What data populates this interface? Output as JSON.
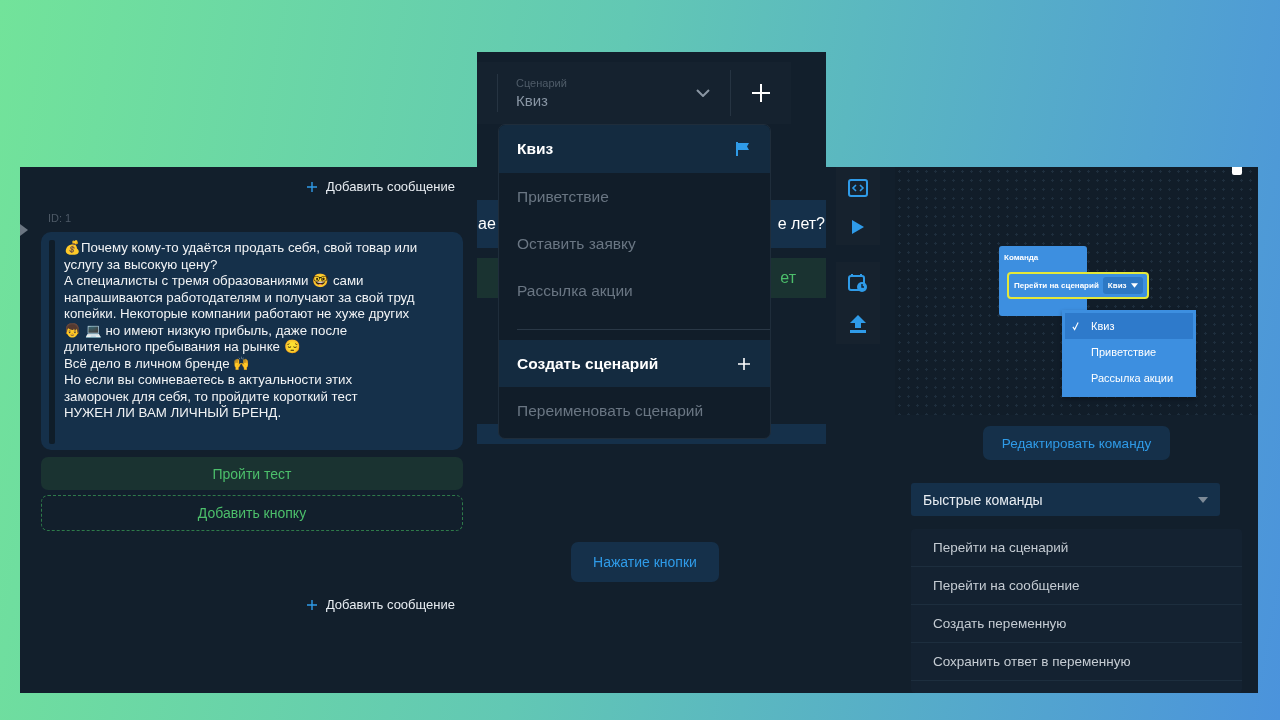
{
  "message_editor": {
    "add_message_top": "Добавить сообщение",
    "id_label": "ID: 1",
    "message": "💰Почему кому-то удаётся продать себя, свой товар или услугу за высокую цену?\nА специалисты с тремя образованиями 🤓 сами напрашиваются работодателям и получают за свой труд копейки. Некоторые компании работают не хуже других 👦 💻 но имеют низкую прибыль, даже после длительного пребывания на рынке 😔\nВсё дело в личном бренде 🙌\nНо если вы сомневаетесь в актуальности этих заморочек для себя, то пройдите короткий тест\nНУЖЕН ЛИ ВАМ ЛИЧНЫЙ БРЕНД.",
    "buttons": [
      {
        "label": "Пройти тест",
        "kind": "reply"
      },
      {
        "label": "Добавить кнопку",
        "kind": "add"
      }
    ],
    "add_message_bottom": "Добавить сообщение"
  },
  "scenario_panel": {
    "select_label": "Сценарий",
    "select_value": "Квиз",
    "scenarios": [
      {
        "label": "Квиз",
        "selected": true
      },
      {
        "label": "Приветствие",
        "selected": false
      },
      {
        "label": "Оставить заявку",
        "selected": false
      },
      {
        "label": "Рассылка акции",
        "selected": false
      }
    ],
    "actions": [
      {
        "label": "Создать сценарий",
        "kind": "create"
      },
      {
        "label": "Переименовать сценарий",
        "kind": "rename"
      }
    ],
    "question_fragments": [
      "ае",
      "е лет?"
    ],
    "answer_fragments": [
      "ет"
    ]
  },
  "trigger_button": "Нажатие кнопки",
  "block_editor": {
    "block_title": "Команда",
    "command": "Перейти на сценарий",
    "field_value": "Квиз",
    "options": [
      {
        "label": "Квиз",
        "selected": true
      },
      {
        "label": "Приветствие",
        "selected": false
      },
      {
        "label": "Рассылка акции",
        "selected": false
      }
    ],
    "edit_button": "Редактировать команду"
  },
  "quick_commands": {
    "title": "Быстрые команды",
    "items": [
      "Перейти на сценарий",
      "Перейти на сообщение",
      "Создать переменную",
      "Сохранить ответ в переменную"
    ]
  }
}
